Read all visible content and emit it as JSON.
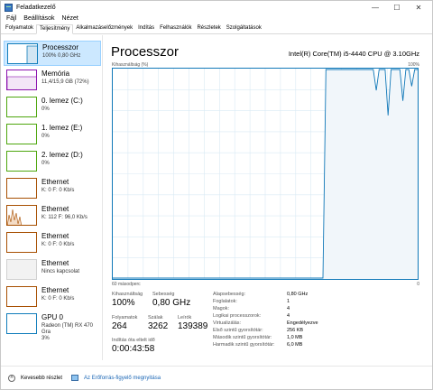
{
  "window": {
    "title": "Feladatkezelő",
    "minimize": "—",
    "maximize": "☐",
    "close": "✕"
  },
  "menu": [
    "Fájl",
    "Beállítások",
    "Nézet"
  ],
  "tabs": [
    "Folyamatok",
    "Teljesítmény",
    "Alkalmazáselőzmények",
    "Indítás",
    "Felhasználók",
    "Részletek",
    "Szolgáltatások"
  ],
  "active_tab": "Teljesítmény",
  "sidebar": {
    "items": [
      {
        "name": "Processzor",
        "sub": "100%  0,80 GHz",
        "selected": true,
        "color": "#117dbb"
      },
      {
        "name": "Memória",
        "sub": "11,4/15,9 GB (72%)",
        "color": "#8b12ae"
      },
      {
        "name": "0. lemez (C:)",
        "sub": "0%",
        "color": "#4da60c"
      },
      {
        "name": "1. lemez (E:)",
        "sub": "0%",
        "color": "#4da60c"
      },
      {
        "name": "2. lemez (D:)",
        "sub": "0%",
        "color": "#4da60c"
      },
      {
        "name": "Ethernet",
        "sub": "K: 0  F: 0 Kb/s",
        "color": "#a74f01"
      },
      {
        "name": "Ethernet",
        "sub": "K: 112  F: 96,0 Kb/s",
        "color": "#a74f01"
      },
      {
        "name": "Ethernet",
        "sub": "K: 0  F: 0 Kb/s",
        "color": "#a74f01"
      },
      {
        "name": "Ethernet",
        "sub": "Nincs kapcsolat",
        "color": "#a74f01"
      },
      {
        "name": "Ethernet",
        "sub": "K: 0  F: 0 Kb/s",
        "color": "#a74f01"
      },
      {
        "name": "GPU 0",
        "sub": "Radeon (TM) RX 470 Gra",
        "sub2": "3%",
        "color": "#117dbb"
      }
    ]
  },
  "main": {
    "title": "Processzor",
    "cpu_name": "Intel(R) Core(TM) i5-4440 CPU @ 3.10GHz",
    "graph_top_left": "Kihasználtság (%)",
    "graph_top_right": "100%",
    "graph_bottom_left": "60 másodperc",
    "graph_bottom_right": "0",
    "stats": {
      "util_label": "Kihasználtság",
      "util_value": "100%",
      "speed_label": "Sebesség",
      "speed_value": "0,80 GHz",
      "proc_label": "Folyamatok",
      "proc_value": "264",
      "threads_label": "Szálak",
      "threads_value": "3262",
      "handles_label": "Leírók",
      "handles_value": "139389",
      "uptime_label": "Indítás óta eltelt idő",
      "uptime_value": "0:00:43:58"
    },
    "props": [
      {
        "k": "Alapsebesség:",
        "v": "0,80 GHz"
      },
      {
        "k": "Foglalatok:",
        "v": "1"
      },
      {
        "k": "Magok:",
        "v": "4"
      },
      {
        "k": "Logikai processzorok:",
        "v": "4"
      },
      {
        "k": "Virtualizálás:",
        "v": "Engedélyezve"
      },
      {
        "k": "Első szintű gyorsítótár:",
        "v": "256 KB"
      },
      {
        "k": "Második szintű gyorsítótár:",
        "v": "1,0 MB"
      },
      {
        "k": "Harmadik szintű gyorsítótár:",
        "v": "6,0 MB"
      }
    ]
  },
  "footer": {
    "less_details": "Kevesebb részlet",
    "resource_monitor": "Az Erőforrás-figyelő megnyitása"
  },
  "colors": {
    "cpu_line": "#1178b8",
    "cpu_fill": "#f1f6fa",
    "grid": "#d9eaf4"
  },
  "chart_data": {
    "type": "area",
    "ylim": [
      0,
      100
    ],
    "values": [
      0,
      0,
      0,
      0,
      0,
      0,
      0,
      0,
      0,
      0,
      0,
      0,
      0,
      0,
      0,
      0,
      0,
      0,
      0,
      0,
      0,
      0,
      0,
      0,
      0,
      0,
      0,
      0,
      0,
      0,
      0,
      0,
      0,
      0,
      0,
      0,
      0,
      0,
      0,
      0,
      0,
      0,
      0,
      0,
      0,
      0,
      0,
      0,
      0,
      0,
      0,
      0,
      0,
      0,
      0,
      0,
      0,
      0,
      0,
      0,
      0,
      0,
      0,
      0,
      0,
      0,
      0,
      0,
      0,
      0,
      0,
      0,
      100,
      100,
      100,
      100,
      100,
      100,
      100,
      100,
      100,
      100,
      100,
      100,
      100,
      100,
      100,
      100,
      100,
      90,
      100,
      100,
      100,
      78,
      100,
      100,
      100,
      100,
      85,
      100,
      100,
      92,
      100,
      100
    ]
  }
}
